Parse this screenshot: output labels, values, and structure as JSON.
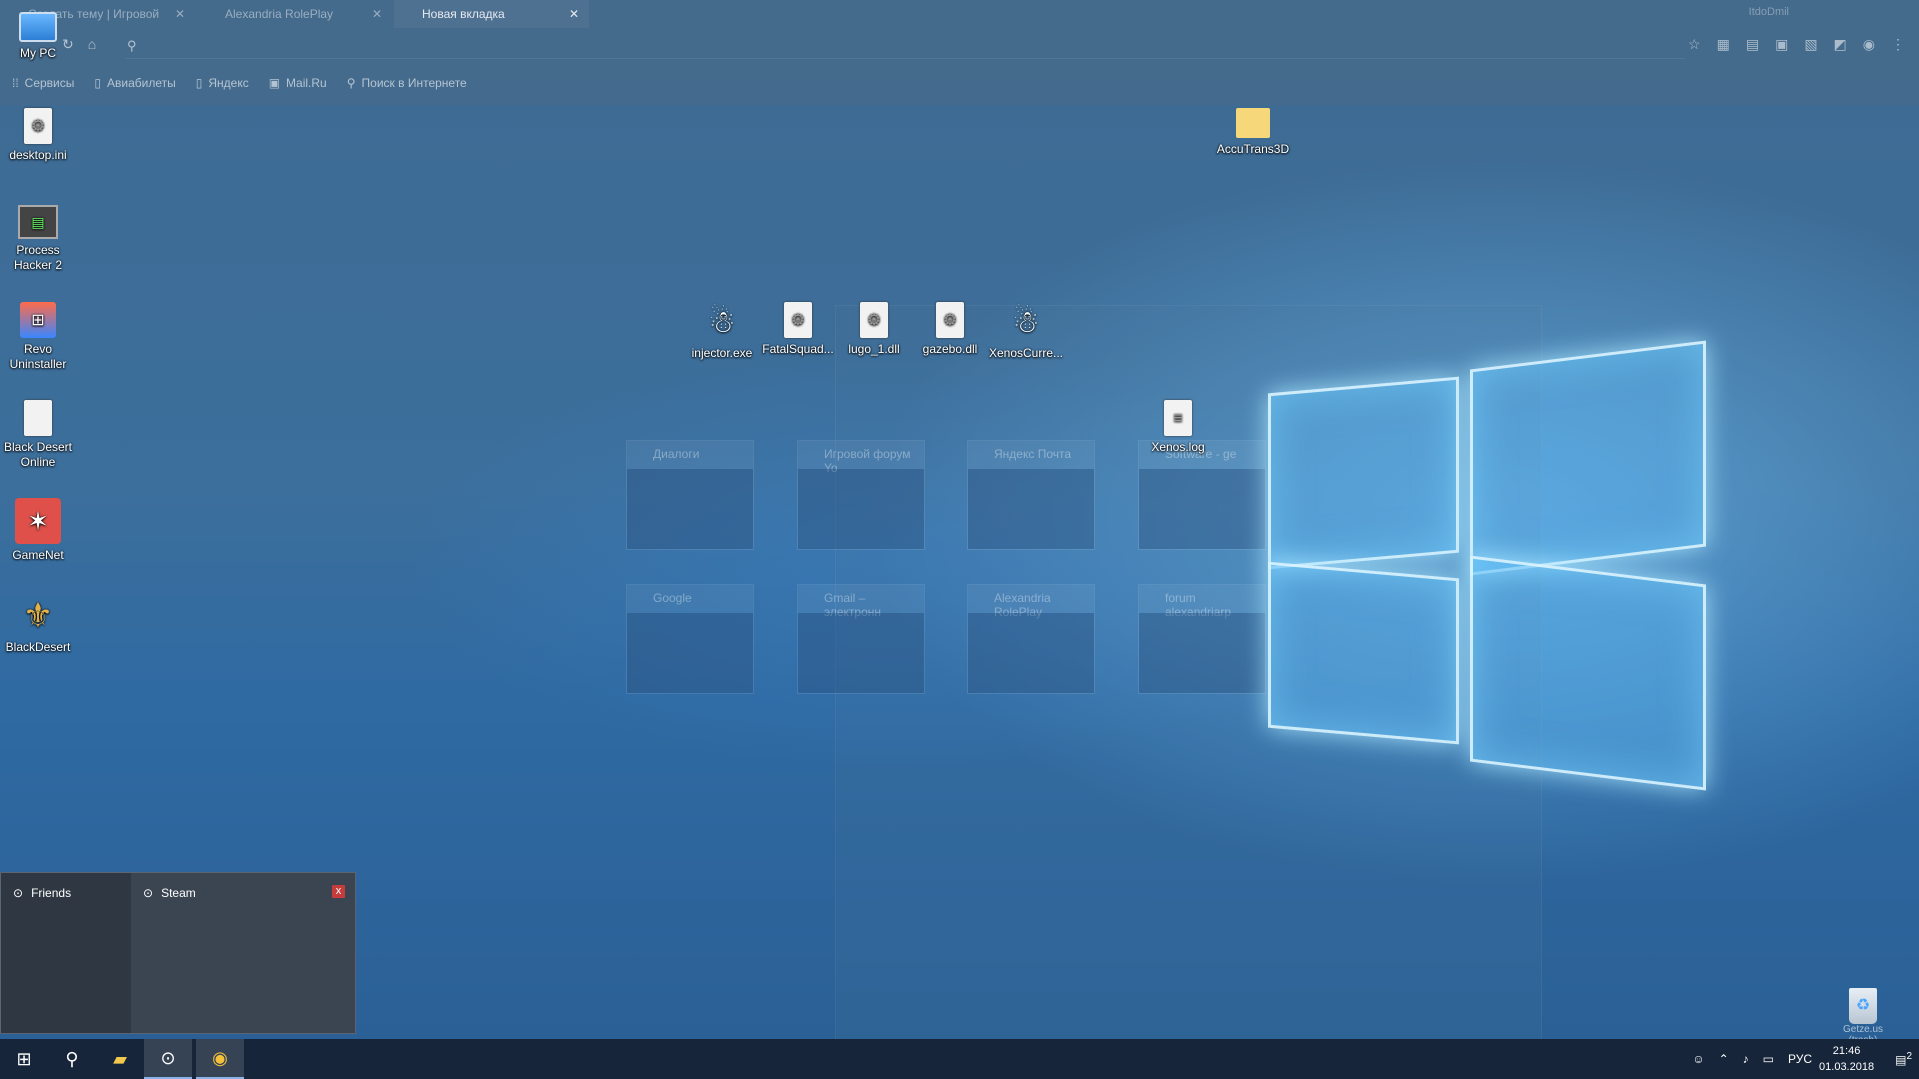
{
  "browser": {
    "tabs": [
      {
        "label": "Создать тему | Игровой",
        "close": "✕"
      },
      {
        "label": "Alexandria RolePlay",
        "close": "✕"
      },
      {
        "label": "Новая вкладка",
        "close": "✕"
      }
    ],
    "profile_name": "ItdoDmil",
    "bookmarks": [
      "Сервисы",
      "Авиабилеты",
      "Яндекс",
      "Mail.Ru",
      "Поиск в Интернете"
    ],
    "speed_dial": [
      "Диалоги",
      "Игровой форум Yo",
      "Яндекс Почта",
      "Software - ge",
      "Google",
      "Gmail – электронн",
      "Alexandria RolePlay",
      "forum alexandriarp"
    ]
  },
  "desktop_left": [
    {
      "label": "My PC",
      "icon": "computer-icon"
    },
    {
      "label": "desktop.ini",
      "icon": "settings-file-icon"
    },
    {
      "label": "Process Hacker 2",
      "icon": "monitor-icon"
    },
    {
      "label": "Revo Uninstaller",
      "icon": "uninstaller-icon"
    },
    {
      "label": "Black Desert Online",
      "icon": "blank-file-icon"
    },
    {
      "label": "GameNet",
      "icon": "gamenet-icon"
    },
    {
      "label": "BlackDesert",
      "icon": "bird-emblem-icon"
    }
  ],
  "desktop_files": [
    {
      "label": "injector.exe"
    },
    {
      "label": "FatalSquad..."
    },
    {
      "label": "lugo_1.dll"
    },
    {
      "label": "gazebo.dll"
    },
    {
      "label": "XenosCurre..."
    },
    {
      "label": "Xenos.log"
    },
    {
      "label": "AccuTrans3D"
    }
  ],
  "steam_popup": {
    "friends": "Friends",
    "steam": "Steam",
    "close": "x"
  },
  "tray": {
    "lang": "РУС",
    "time": "21:46",
    "date": "01.03.2018",
    "notifications": "2"
  },
  "recycle_bin": {
    "label": "Getze.us (trash)"
  }
}
